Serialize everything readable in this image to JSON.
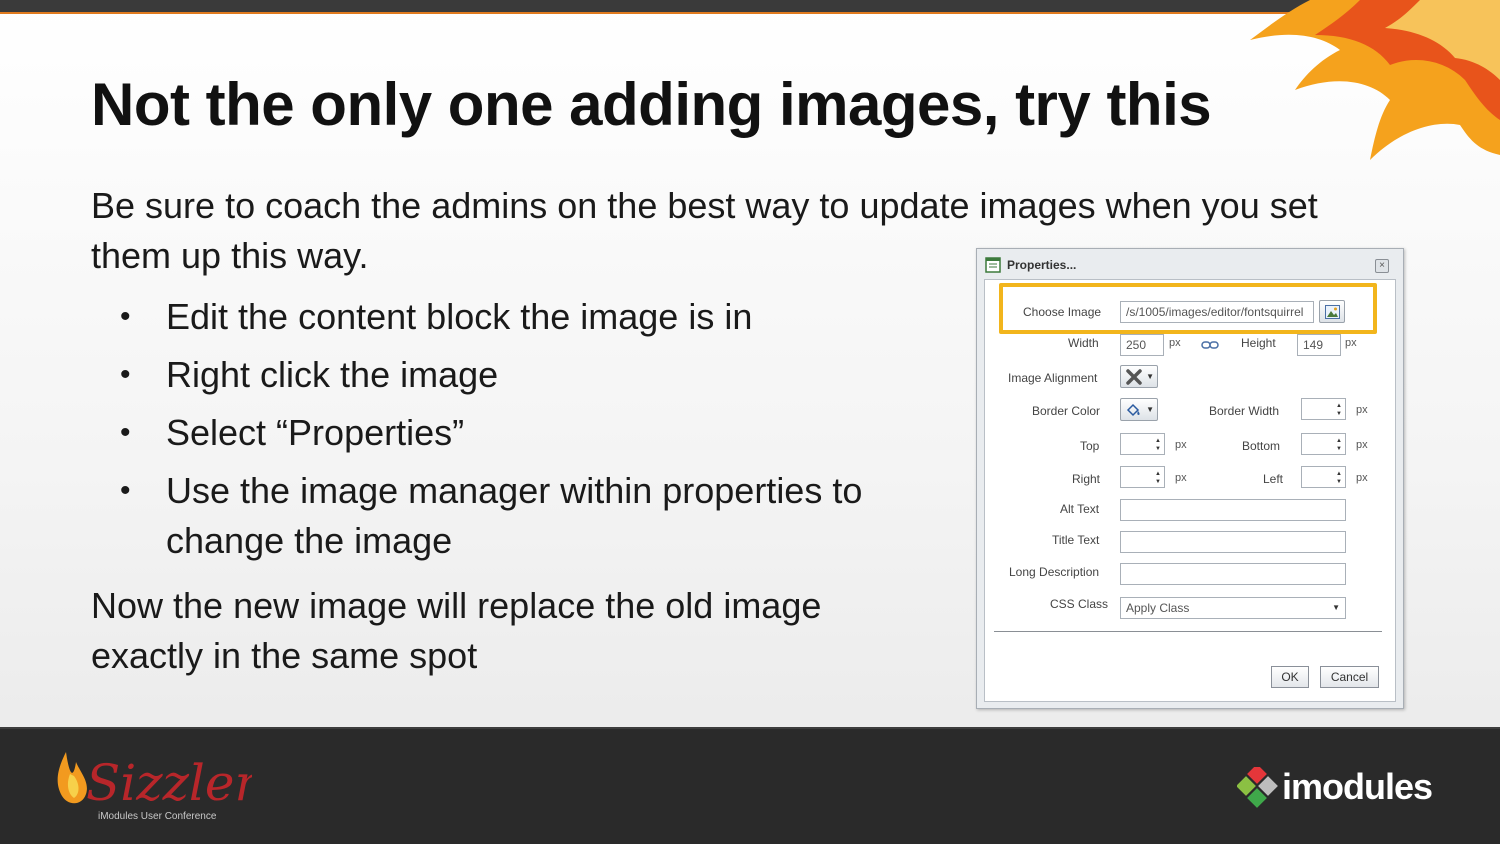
{
  "slide": {
    "title": "Not the only one adding images, try this",
    "intro": "Be sure to coach the admins on the best way to update images when you set them up this way.",
    "bullets": [
      "Edit the content block the image is in",
      "Right click the image",
      "Select “Properties”",
      "Use the image manager within properties to change the image"
    ],
    "bullet_glyph": "•",
    "outro": "Now the new image will replace the old image exactly in the same spot"
  },
  "dialog": {
    "title": "Properties...",
    "close_glyph": "×",
    "choose_image_label": "Choose Image",
    "choose_image_value": "/s/1005/images/editor/fontsquirrel",
    "width_label": "Width",
    "width_value": "250",
    "height_label": "Height",
    "height_value": "149",
    "px": "px",
    "image_alignment_label": "Image Alignment",
    "border_color_label": "Border Color",
    "border_width_label": "Border Width",
    "top_label": "Top",
    "bottom_label": "Bottom",
    "right_label": "Right",
    "left_label": "Left",
    "alt_text_label": "Alt Text",
    "title_text_label": "Title Text",
    "long_description_label": "Long Description",
    "css_class_label": "CSS Class",
    "css_class_value": "Apply Class",
    "ok_label": "OK",
    "cancel_label": "Cancel",
    "spinner_up": "▲",
    "spinner_down": "▼",
    "dropdown_caret": "▼"
  },
  "footer": {
    "sizzler_logo": "Sizzler",
    "sizzler_subtitle": "iModules User Conference",
    "imodules_logo": "imodules"
  },
  "colors": {
    "highlight": "#f2b51c",
    "topbar": "#3a3a3a",
    "footer": "#2a2a2a"
  }
}
